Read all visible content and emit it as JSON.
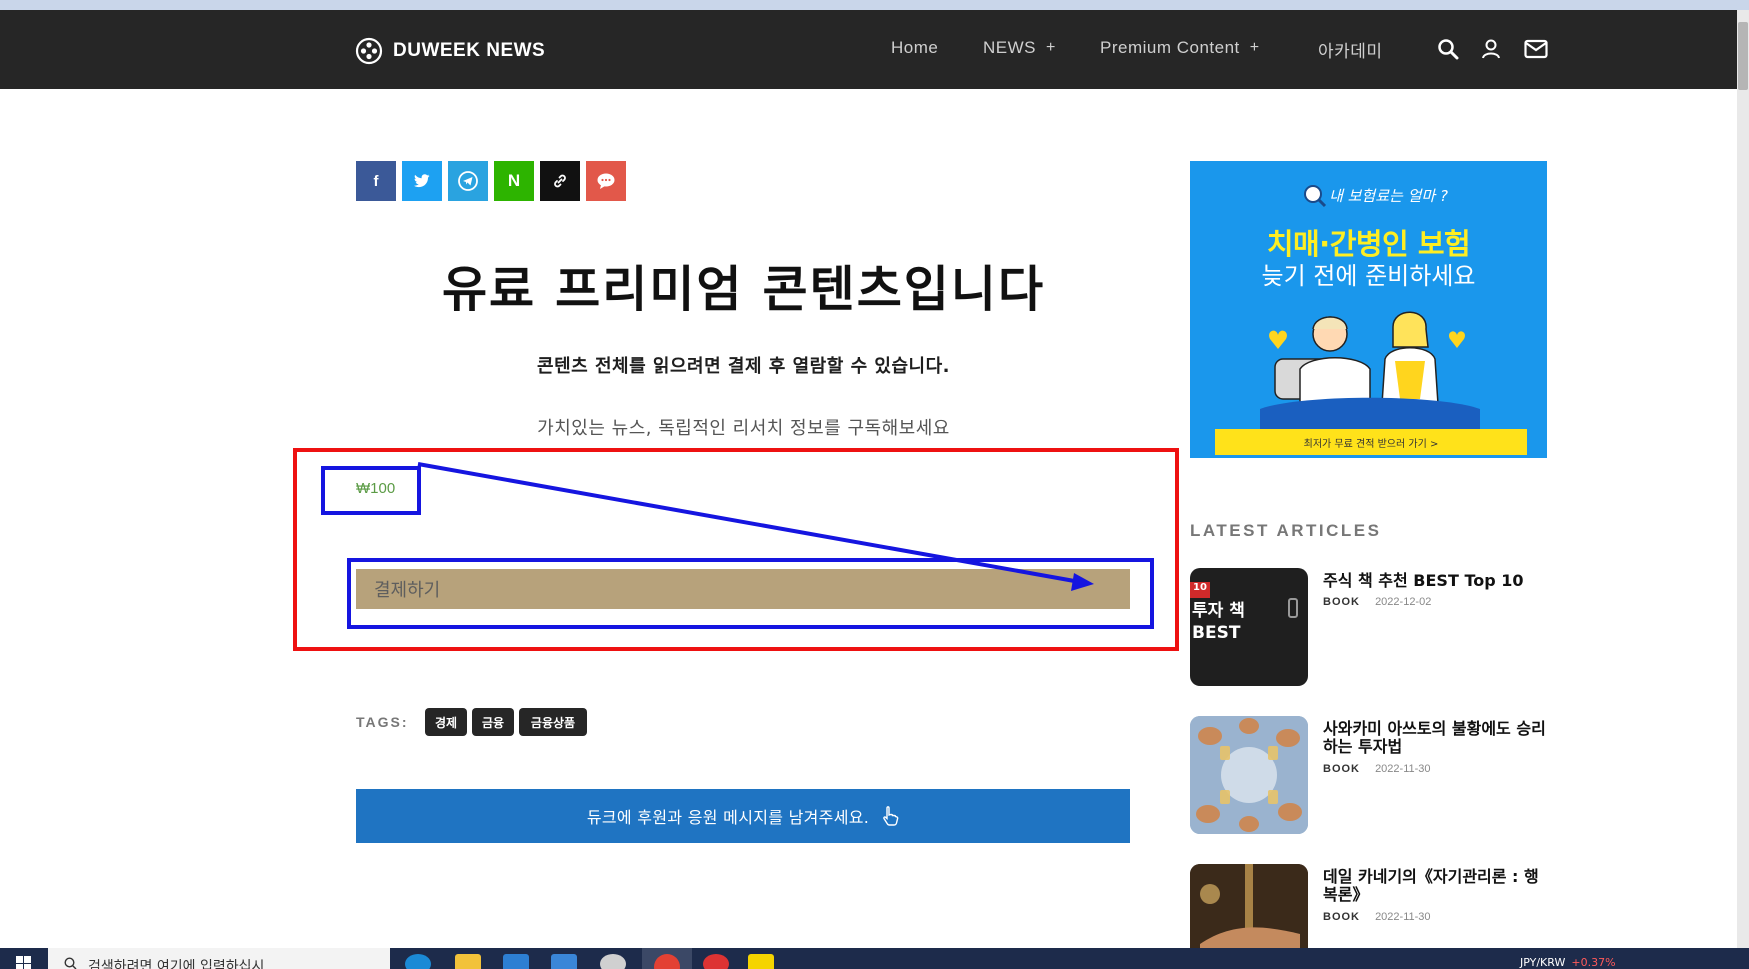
{
  "site": {
    "logo_text": "DUWEEK NEWS",
    "nav": [
      {
        "label": "Home",
        "has_plus": false
      },
      {
        "label": "NEWS",
        "has_plus": true
      },
      {
        "label": "Premium Content",
        "has_plus": true
      },
      {
        "label": "아카데미",
        "has_plus": false
      }
    ],
    "plus_symbol": "+",
    "icons": [
      "search-icon",
      "user-icon",
      "mail-icon"
    ]
  },
  "share": [
    {
      "name": "facebook",
      "glyph": "f",
      "color": "#3b5998"
    },
    {
      "name": "twitter",
      "glyph": "t",
      "color": "#1da1f2"
    },
    {
      "name": "telegram",
      "glyph": "",
      "color": "#2aa3e0"
    },
    {
      "name": "naver",
      "glyph": "N",
      "color": "#2db400"
    },
    {
      "name": "copy-link",
      "glyph": "",
      "color": "#111111"
    },
    {
      "name": "comment",
      "glyph": "",
      "color": "#e2584a"
    }
  ],
  "content": {
    "title": "유료 프리미엄 콘텐츠입니다",
    "subtitle": "콘텐츠 전체를 읽으려면 결제 후 열람할 수 있습니다.",
    "description": "가치있는 뉴스, 독립적인 리서치 정보를 구독해보세요",
    "price": "₩100",
    "pay_button": "결제하기",
    "tags_label": "TAGS:",
    "tags": [
      "경제",
      "금융",
      "금융상품"
    ],
    "support_button": "듀크에 후원과 응원 메시지를 남겨주세요."
  },
  "annotation_colors": {
    "red_box": "#ee1111",
    "blue_box": "#1515e0"
  },
  "ad": {
    "top_text": "내 보험료는 얼마 ?",
    "line1": "치매·간병인 보험",
    "line2": "늦기 전에 준비하세요",
    "bottom_bar": "최저가 무료 견적 받으러 가기 >"
  },
  "sidebar": {
    "latest_label": "LATEST ARTICLES",
    "articles": [
      {
        "title": "주식 책 추천 BEST Top 10",
        "category": "BOOK",
        "date": "2022-12-02",
        "thumb_text": "투자 책 BEST"
      },
      {
        "title": "사와카미 아쓰토의 불황에도 승리하는 투자법",
        "category": "BOOK",
        "date": "2022-11-30",
        "thumb_text": ""
      },
      {
        "title": "데일 카네기의《자기관리론 : 행복론》",
        "category": "BOOK",
        "date": "2022-11-30",
        "thumb_text": ""
      }
    ]
  },
  "taskbar": {
    "search_placeholder": "검색하려면 여기에 입력하십시",
    "tray_ticker": "JPY/KRW",
    "tray_change": "+0.37%"
  }
}
